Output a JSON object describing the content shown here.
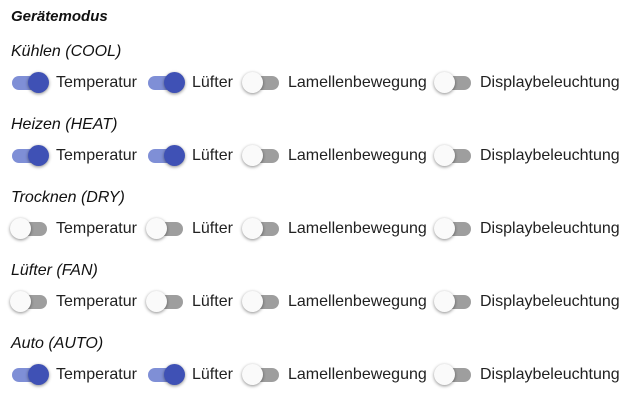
{
  "title": "Gerätemodus",
  "modes": [
    {
      "label": "Kühlen (COOL)",
      "toggles": [
        {
          "label": "Temperatur",
          "on": true
        },
        {
          "label": "Lüfter",
          "on": true
        },
        {
          "label": "Lamellenbewegung",
          "on": false
        },
        {
          "label": "Displaybeleuchtung",
          "on": false
        }
      ]
    },
    {
      "label": "Heizen (HEAT)",
      "toggles": [
        {
          "label": "Temperatur",
          "on": true
        },
        {
          "label": "Lüfter",
          "on": true
        },
        {
          "label": "Lamellenbewegung",
          "on": false
        },
        {
          "label": "Displaybeleuchtung",
          "on": false
        }
      ]
    },
    {
      "label": "Trocknen (DRY)",
      "toggles": [
        {
          "label": "Temperatur",
          "on": false
        },
        {
          "label": "Lüfter",
          "on": false
        },
        {
          "label": "Lamellenbewegung",
          "on": false
        },
        {
          "label": "Displaybeleuchtung",
          "on": false
        }
      ]
    },
    {
      "label": "Lüfter (FAN)",
      "toggles": [
        {
          "label": "Temperatur",
          "on": false
        },
        {
          "label": "Lüfter",
          "on": false
        },
        {
          "label": "Lamellenbewegung",
          "on": false
        },
        {
          "label": "Displaybeleuchtung",
          "on": false
        }
      ]
    },
    {
      "label": "Auto (AUTO)",
      "toggles": [
        {
          "label": "Temperatur",
          "on": true
        },
        {
          "label": "Lüfter",
          "on": true
        },
        {
          "label": "Lamellenbewegung",
          "on": false
        },
        {
          "label": "Displaybeleuchtung",
          "on": false
        }
      ]
    }
  ],
  "colors": {
    "accent_thumb": "#3f51b5",
    "accent_track": "#7f8fd6",
    "off_track": "#9e9e9e",
    "off_thumb": "#fafafa"
  }
}
